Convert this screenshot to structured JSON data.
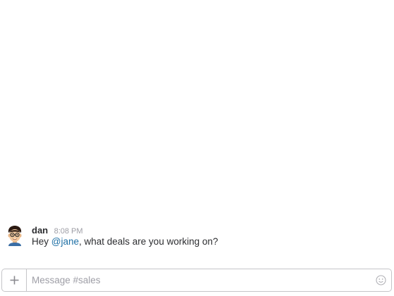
{
  "message": {
    "author": "dan",
    "timestamp": "8:08 PM",
    "text_before": "Hey ",
    "mention": "@jane",
    "text_after": ", what deals are you working on?",
    "avatar_icon": "avatar-bitmoji-icon"
  },
  "composer": {
    "placeholder": "Message #sales",
    "attach_icon": "plus-icon",
    "emoji_icon": "smiley-icon"
  },
  "colors": {
    "mention": "#1d6fa5",
    "timestamp": "#9e9ea6",
    "border": "#c5c5c8"
  }
}
